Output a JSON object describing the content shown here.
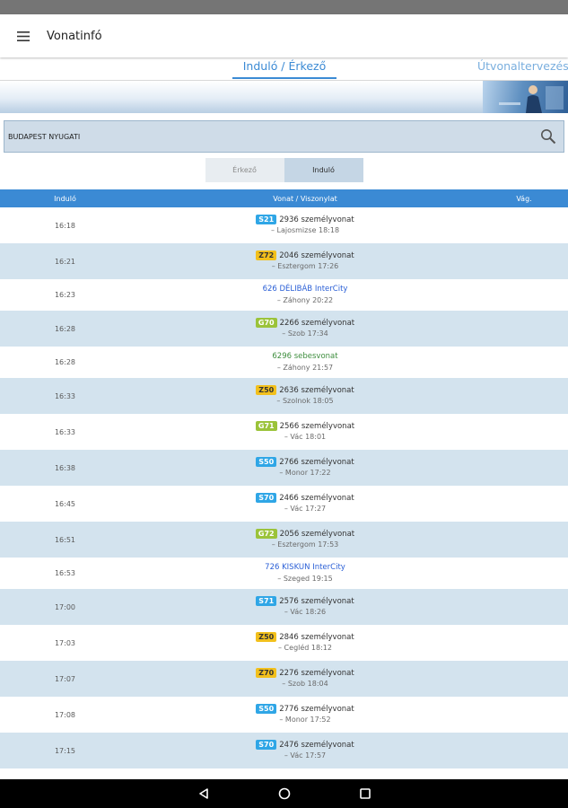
{
  "app": {
    "title": "Vonatinfó"
  },
  "tabs": [
    {
      "label": "Induló / Érkező",
      "active": true
    },
    {
      "label": "Útvonaltervezés",
      "active": false
    }
  ],
  "search": {
    "value": "BUDAPEST NYUGATI"
  },
  "toggle": {
    "erkezo": "Érkező",
    "indulo": "Induló",
    "selected": "Induló"
  },
  "table": {
    "headers": {
      "time": "Induló",
      "train": "Vonat / Viszonylat",
      "track": "Vág."
    },
    "rows": [
      {
        "time": "16:18",
        "badge": "S21",
        "badge_color": "#2fa6e6",
        "badge_text": "#ffffff",
        "name": "2936 személyvonat",
        "dest": "– Lajosmizse 18:18",
        "style": "plain"
      },
      {
        "time": "16:21",
        "badge": "Z72",
        "badge_color": "#f2c01c",
        "badge_text": "#333333",
        "name": "2046 személyvonat",
        "dest": "– Esztergom 17:26",
        "style": "plain"
      },
      {
        "time": "16:23",
        "badge": "",
        "badge_color": "",
        "badge_text": "",
        "name": "626 DÉLIBÁB InterCity",
        "dest": "– Záhony 20:22",
        "style": "blue"
      },
      {
        "time": "16:28",
        "badge": "G70",
        "badge_color": "#9bc33a",
        "badge_text": "#ffffff",
        "name": "2266 személyvonat",
        "dest": "– Szob 17:34",
        "style": "plain"
      },
      {
        "time": "16:28",
        "badge": "",
        "badge_color": "",
        "badge_text": "",
        "name": "6296 sebesvonat",
        "dest": "– Záhony 21:57",
        "style": "green"
      },
      {
        "time": "16:33",
        "badge": "Z50",
        "badge_color": "#f2c01c",
        "badge_text": "#333333",
        "name": "2636 személyvonat",
        "dest": "– Szolnok 18:05",
        "style": "plain"
      },
      {
        "time": "16:33",
        "badge": "G71",
        "badge_color": "#9bc33a",
        "badge_text": "#ffffff",
        "name": "2566 személyvonat",
        "dest": "– Vác 18:01",
        "style": "plain"
      },
      {
        "time": "16:38",
        "badge": "S50",
        "badge_color": "#2fa6e6",
        "badge_text": "#ffffff",
        "name": "2766 személyvonat",
        "dest": "– Monor 17:22",
        "style": "plain"
      },
      {
        "time": "16:45",
        "badge": "S70",
        "badge_color": "#2fa6e6",
        "badge_text": "#ffffff",
        "name": "2466 személyvonat",
        "dest": "– Vác 17:27",
        "style": "plain"
      },
      {
        "time": "16:51",
        "badge": "G72",
        "badge_color": "#9bc33a",
        "badge_text": "#ffffff",
        "name": "2056 személyvonat",
        "dest": "– Esztergom 17:53",
        "style": "plain"
      },
      {
        "time": "16:53",
        "badge": "",
        "badge_color": "",
        "badge_text": "",
        "name": "726 KISKUN InterCity",
        "dest": "– Szeged 19:15",
        "style": "blue"
      },
      {
        "time": "17:00",
        "badge": "S71",
        "badge_color": "#2fa6e6",
        "badge_text": "#ffffff",
        "name": "2576 személyvonat",
        "dest": "– Vác 18:26",
        "style": "plain"
      },
      {
        "time": "17:03",
        "badge": "Z50",
        "badge_color": "#f2c01c",
        "badge_text": "#333333",
        "name": "2846 személyvonat",
        "dest": "– Cegléd 18:12",
        "style": "plain"
      },
      {
        "time": "17:07",
        "badge": "Z70",
        "badge_color": "#f2c01c",
        "badge_text": "#333333",
        "name": "2276 személyvonat",
        "dest": "– Szob 18:04",
        "style": "plain"
      },
      {
        "time": "17:08",
        "badge": "S50",
        "badge_color": "#2fa6e6",
        "badge_text": "#ffffff",
        "name": "2776 személyvonat",
        "dest": "– Monor 17:52",
        "style": "plain"
      },
      {
        "time": "17:15",
        "badge": "S70",
        "badge_color": "#2fa6e6",
        "badge_text": "#ffffff",
        "name": "2476 személyvonat",
        "dest": "– Vác 17:57",
        "style": "plain"
      }
    ]
  },
  "icons": {
    "menu": "menu-icon",
    "search": "search-icon",
    "back": "back-icon",
    "home": "home-icon",
    "recents": "recents-icon"
  },
  "colors": {
    "accent": "#3b8ad4",
    "row_alt": "#d3e3ee",
    "search_bg": "#cfdce8",
    "intercity": "#2a5fd6",
    "express": "#3e8e3e"
  }
}
